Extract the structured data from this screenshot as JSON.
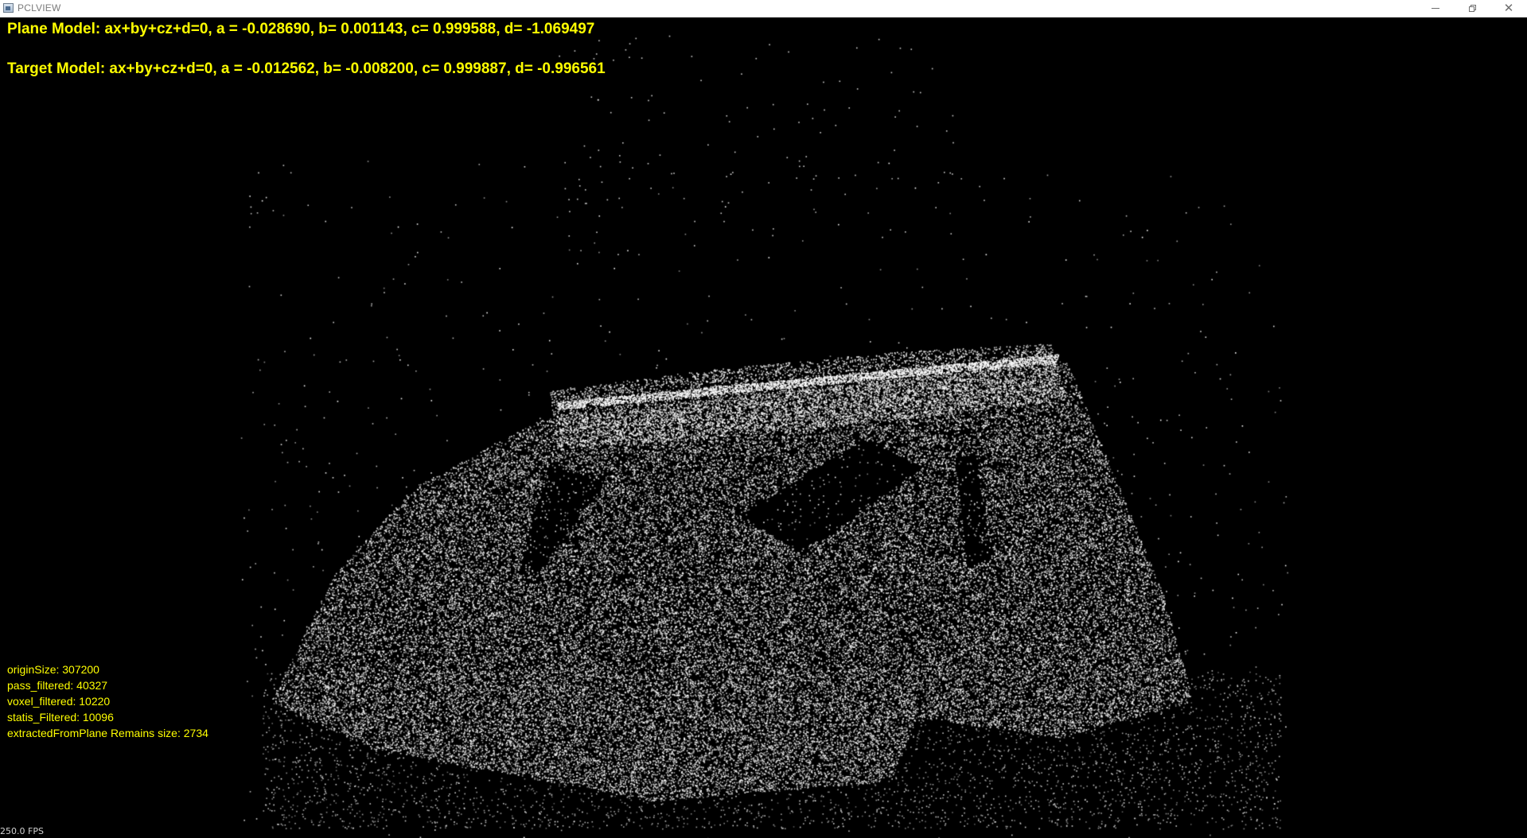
{
  "window": {
    "title": "PCLVIEW",
    "icon": "app-window-icon",
    "controls": {
      "minimize_icon": "minimize-icon",
      "maximize_icon": "restore-icon",
      "close_label": "✕"
    }
  },
  "overlay": {
    "plane_model": "Plane Model: ax+by+cz+d=0, a = -0.028690, b= 0.001143, c= 0.999588, d= -1.069497",
    "target_model": "Target Model: ax+by+cz+d=0, a = -0.012562, b= -0.008200, c= 0.999887, d= -0.996561",
    "stats": [
      "originSize: 307200",
      "pass_filtered: 40327",
      "voxel_filtered: 10220",
      "statis_Filtered: 10096",
      "extractedFromPlane Remains size: 2734"
    ],
    "fps": "250.0 FPS"
  },
  "colors": {
    "background": "#000000",
    "overlay_text": "#ffff00",
    "points": "#ffffff"
  }
}
